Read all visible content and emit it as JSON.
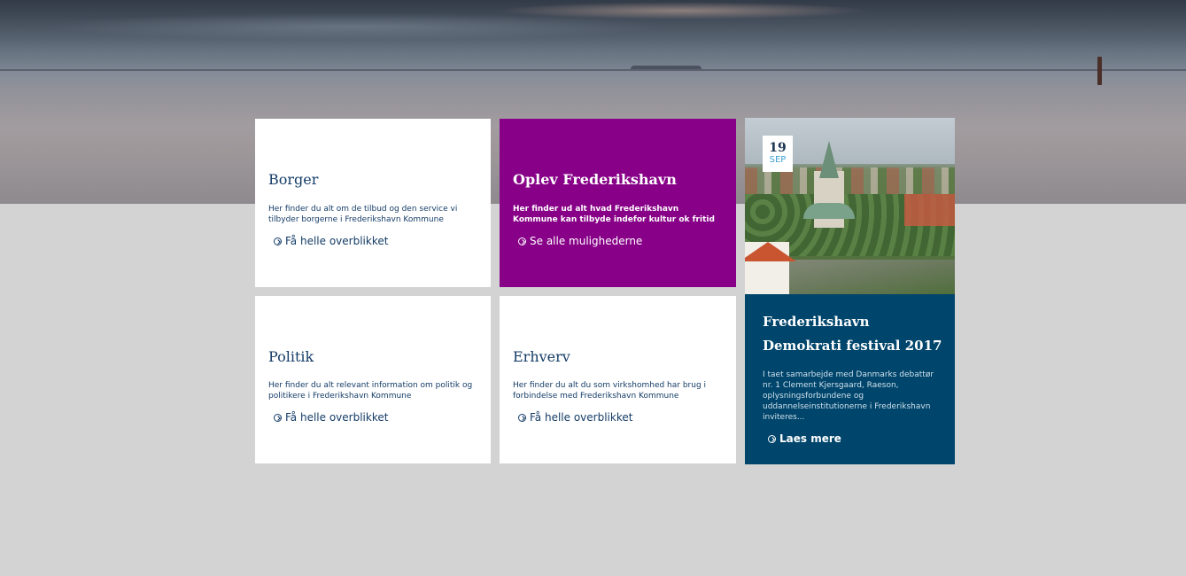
{
  "tiles": {
    "borger": {
      "title": "Borger",
      "text": "Her finder du alt om de tilbud og den service vi tilbyder borgerne i Frederikshavn Kommune",
      "link": "Få helle overblikket"
    },
    "oplev": {
      "title": "Oplev Frederikshavn",
      "text": "Her finder ud alt hvad Frederikshavn Kommune kan tilbyde indefor kultur ok fritid",
      "link": "Se alle mulighederne",
      "color": "#870087"
    },
    "politik": {
      "title": "Politik",
      "text": "Her finder du alt relevant information om politik og politikere i Frederikshavn Kommune",
      "link": "Få helle overblikket"
    },
    "erhverv": {
      "title": "Erhverv",
      "text": "Her finder du alt du som virkshomhed har brug i forbindelse med Frederikshavn Kommune",
      "link": "Få helle overblikket"
    }
  },
  "news": {
    "day": "19",
    "month": "SEP",
    "title": "Frederikshavn Demokrati festival 2017",
    "text": "I taet samarbejde med Danmarks debattør nr. 1 Clement Kjersgaard, Raeson, oplysningsforbundene og uddannelseinstitutionerne i Frederikshavn inviteres...",
    "link": "Laes mere",
    "color": "#00456b"
  },
  "colors": {
    "page_bg": "#d3d3d3",
    "text_blue": "#143c67",
    "date_accent": "#3aa0d6"
  },
  "icons": {
    "link_icon": "circle-chevron-right-icon"
  }
}
